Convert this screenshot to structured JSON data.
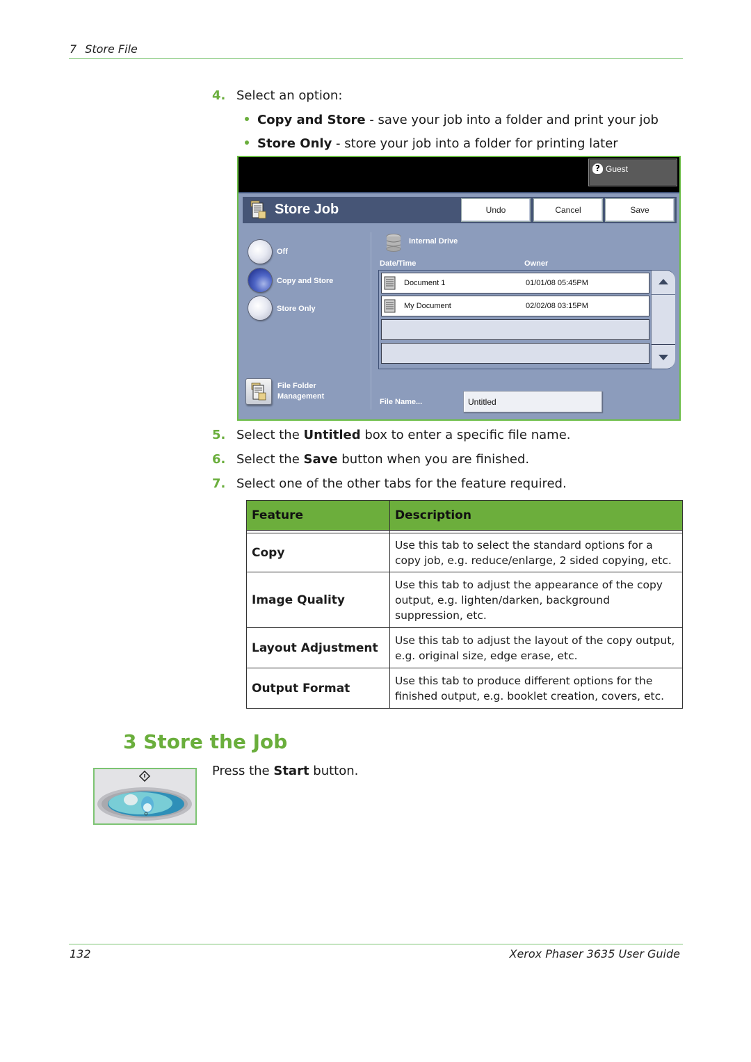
{
  "header": {
    "chapter_number": "7",
    "chapter_title": "Store File"
  },
  "steps_before": {
    "step4": {
      "number": "4.",
      "text": "Select an option:"
    },
    "options": [
      {
        "bold": "Copy and Store",
        "rest": " - save your job into a folder and print your job"
      },
      {
        "bold": "Store Only",
        "rest": " - store your job into a folder for printing later"
      }
    ]
  },
  "screen": {
    "user_button": "Guest",
    "title": "Store Job",
    "buttons": {
      "undo": "Undo",
      "cancel": "Cancel",
      "save": "Save"
    },
    "radio_options": [
      {
        "label": "Off",
        "selected": false
      },
      {
        "label": "Copy and Store",
        "selected": true
      },
      {
        "label": "Store Only",
        "selected": false
      }
    ],
    "drive_label": "Internal Drive",
    "columns": {
      "datetime": "Date/Time",
      "owner": "Owner"
    },
    "files": [
      {
        "name": "Document 1",
        "date": "01/01/08 05:45PM"
      },
      {
        "name": "My Document",
        "date": "02/02/08 03:15PM"
      }
    ],
    "file_folder_management": [
      "File Folder",
      "Management"
    ],
    "file_name_label": "File Name...",
    "file_name_value": "Untitled",
    "colors": {
      "accent_green": "#6cbe45",
      "panel": "#8c9cbc",
      "title_bar": "#465576"
    }
  },
  "steps_after": [
    {
      "number": "5.",
      "pre": "Select the ",
      "bold": "Untitled",
      "post": " box to enter a specific file name."
    },
    {
      "number": "6.",
      "pre": "Select the ",
      "bold": "Save",
      "post": " button when you are finished."
    },
    {
      "number": "7.",
      "pre": "Select one of the other tabs for the feature required.",
      "bold": "",
      "post": ""
    }
  ],
  "feature_table": {
    "headers": [
      "Feature",
      "Description"
    ],
    "rows": [
      {
        "feature": "Copy",
        "description": "Use this tab to select the standard options for a copy job, e.g. reduce/enlarge, 2 sided copying, etc."
      },
      {
        "feature": "Image Quality",
        "description": "Use this tab to adjust the appearance of the copy output, e.g. lighten/darken, background suppression, etc."
      },
      {
        "feature": "Layout Adjustment",
        "description": "Use this tab to adjust the layout of the copy output, e.g. original size, edge erase, etc."
      },
      {
        "feature": "Output Format",
        "description": "Use this tab to produce different options for the finished output, e.g. booklet creation, covers, etc."
      }
    ]
  },
  "section": {
    "title": "3 Store the Job",
    "press_pre": "Press the ",
    "press_bold": "Start",
    "press_post": " button."
  },
  "footer": {
    "page_number": "132",
    "guide_name": "Xerox Phaser 3635 User Guide"
  }
}
